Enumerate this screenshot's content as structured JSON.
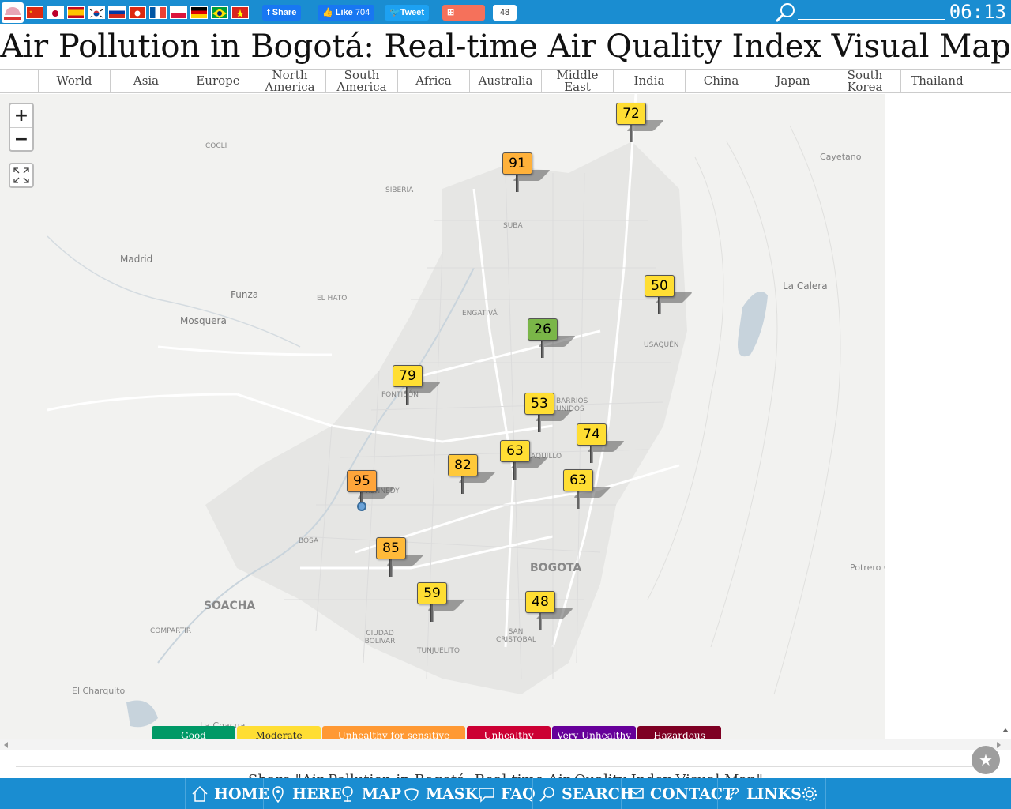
{
  "topbar": {
    "facebook_share": "Share",
    "like_label": "Like",
    "like_count": "704",
    "tweet": "Tweet",
    "share": "Share",
    "share_count": "48",
    "clock": "06:13",
    "flags": [
      "china",
      "japan",
      "spain",
      "korea",
      "russia",
      "hong-kong",
      "france",
      "poland",
      "germany",
      "brazil",
      "vietnam"
    ]
  },
  "title": "Air Pollution in Bogotá: Real-time Air Quality Index Visual Map",
  "regions": [
    "World",
    "Asia",
    "Europe",
    "North America",
    "South America",
    "Africa",
    "Australia",
    "Middle East",
    "India",
    "China",
    "Japan",
    "South Korea",
    "Thailand"
  ],
  "map": {
    "zoom_in": "+",
    "zoom_out": "−",
    "places": [
      "Cayetano",
      "COCLI",
      "SIBERIA",
      "SUBA",
      "Madrid",
      "Funza",
      "EL HATO",
      "Mosquera",
      "La Calera",
      "ENGATIVÁ",
      "USAQUÉN",
      "FONTIBÓN",
      "BARRIOS UNIDOS",
      "AQUILLO",
      "KENNEDY",
      "BOSA",
      "BOGOTA",
      "Potrero C",
      "SOACHA",
      "COMPARTIR",
      "CIUDAD BOLIVAR",
      "TUNJUELITO",
      "SAN CRISTOBAL",
      "El Charquito",
      "La Chacua"
    ],
    "markers": [
      {
        "aqi": "72",
        "color": "#ffde33"
      },
      {
        "aqi": "91",
        "color": "#ffb13a"
      },
      {
        "aqi": "50",
        "color": "#ffde33"
      },
      {
        "aqi": "26",
        "color": "#7ab648"
      },
      {
        "aqi": "79",
        "color": "#ffde33"
      },
      {
        "aqi": "53",
        "color": "#ffde33"
      },
      {
        "aqi": "74",
        "color": "#ffde33"
      },
      {
        "aqi": "63",
        "color": "#ffde33"
      },
      {
        "aqi": "82",
        "color": "#ffc93a"
      },
      {
        "aqi": "63",
        "color": "#ffde33"
      },
      {
        "aqi": "95",
        "color": "#ffa53a"
      },
      {
        "aqi": "85",
        "color": "#ffba3a"
      },
      {
        "aqi": "59",
        "color": "#ffde33"
      },
      {
        "aqi": "48",
        "color": "#ffde33"
      }
    ]
  },
  "legend": [
    {
      "label": "Good",
      "color": "#009966"
    },
    {
      "label": "Moderate",
      "color": "#ffde33"
    },
    {
      "label": "Unhealthy for sensitive groups",
      "color": "#ff9933"
    },
    {
      "label": "Unhealthy",
      "color": "#cc0033"
    },
    {
      "label": "Very Unhealthy",
      "color": "#660099"
    },
    {
      "label": "Hazardous",
      "color": "#7e0023"
    }
  ],
  "share_text": "Share \"Air Pollution in Bogotá: Real-time Air Quality Index Visual Map\"",
  "bottom_nav": [
    "HOME",
    "HERE",
    "MAP",
    "MASK",
    "FAQ",
    "SEARCH",
    "CONTACT",
    "LINKS"
  ]
}
